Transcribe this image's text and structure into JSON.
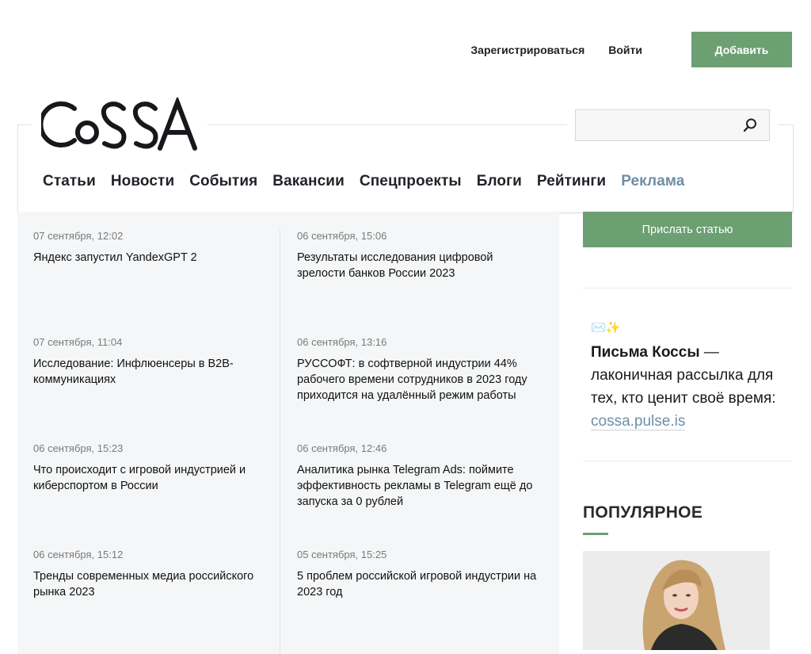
{
  "topbar": {
    "register": "Зарегистрироваться",
    "login": "Войти",
    "add": "Добавить"
  },
  "brand": {
    "logo_text": "CoSSA",
    "accent": "#6c9f72"
  },
  "search": {
    "placeholder": "",
    "icon": "search-icon"
  },
  "nav": {
    "items": [
      {
        "label": "Статьи"
      },
      {
        "label": "Новости"
      },
      {
        "label": "События"
      },
      {
        "label": "Вакансии"
      },
      {
        "label": "Спецпроекты"
      },
      {
        "label": "Блоги"
      },
      {
        "label": "Рейтинги"
      },
      {
        "label": "Реклама"
      }
    ]
  },
  "news": {
    "left": [
      {
        "date": "07 сентября, 12:02",
        "title": "Яндекс запустил YandexGPT 2"
      },
      {
        "date": "07 сентября, 11:04",
        "title": "Исследование: Инфлюенсеры в B2B-коммуникациях"
      },
      {
        "date": "06 сентября, 15:23",
        "title": "Что происходит с игровой индустрией и киберспортом в России"
      },
      {
        "date": "06 сентября, 15:12",
        "title": "Тренды современных медиа российского рынка 2023"
      }
    ],
    "right": [
      {
        "date": "06 сентября, 15:06",
        "title": "Результаты исследования цифровой зрелости банков России 2023"
      },
      {
        "date": "06 сентября, 13:16",
        "title": "РУССОФТ: в софтверной индустрии 44% рабочего времени сотрудников в 2023 году приходится на удалённый режим работы"
      },
      {
        "date": "06 сентября, 12:46",
        "title": "Аналитика рынка Telegram Ads: поймите эффективность рекламы в Telegram ещё до запуска за 0 рублей"
      },
      {
        "date": "05 сентября, 15:25",
        "title": "5 проблем российской игровой индустрии на 2023 год"
      }
    ]
  },
  "sidebar": {
    "send_article": "Прислать статью",
    "newsletter": {
      "emoji": "✉️✨",
      "bold": "Письма Коссы",
      "text": " — лаконичная рассылка для тех, кто ценит своё время: ",
      "link": "cossa.pulse.is"
    },
    "popular_title": "ПОПУЛЯРНОЕ"
  }
}
